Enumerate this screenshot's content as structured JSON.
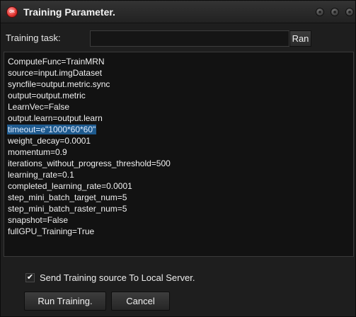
{
  "window": {
    "title": "Training Parameter.",
    "app_icon_text": "OK"
  },
  "task": {
    "label": "Training task:",
    "value": "",
    "ran_button": "Ran"
  },
  "editor": {
    "lines": [
      "ComputeFunc=TrainMRN",
      "source=input.imgDataset",
      "syncfile=output.metric.sync",
      "output=output.metric",
      "LearnVec=False",
      "output.learn=output.learn",
      "timeout=e\"1000*60*60\"",
      "weight_decay=0.0001",
      "momentum=0.9",
      "iterations_without_progress_threshold=500",
      "learning_rate=0.1",
      "completed_learning_rate=0.0001",
      "step_mini_batch_target_num=5",
      "step_mini_batch_raster_num=5",
      "snapshot=False",
      "fullGPU_Training=True"
    ],
    "selected_line_index": 6
  },
  "send_option": {
    "checked": true,
    "check_glyph": "✔",
    "label": "Send Training source To Local Server."
  },
  "buttons": {
    "run": "Run Training.",
    "cancel": "Cancel"
  },
  "colors": {
    "background": "#1e1e1e",
    "editor_background": "#121212",
    "selection": "#1e5a8e",
    "app_icon": "#e0342f"
  }
}
